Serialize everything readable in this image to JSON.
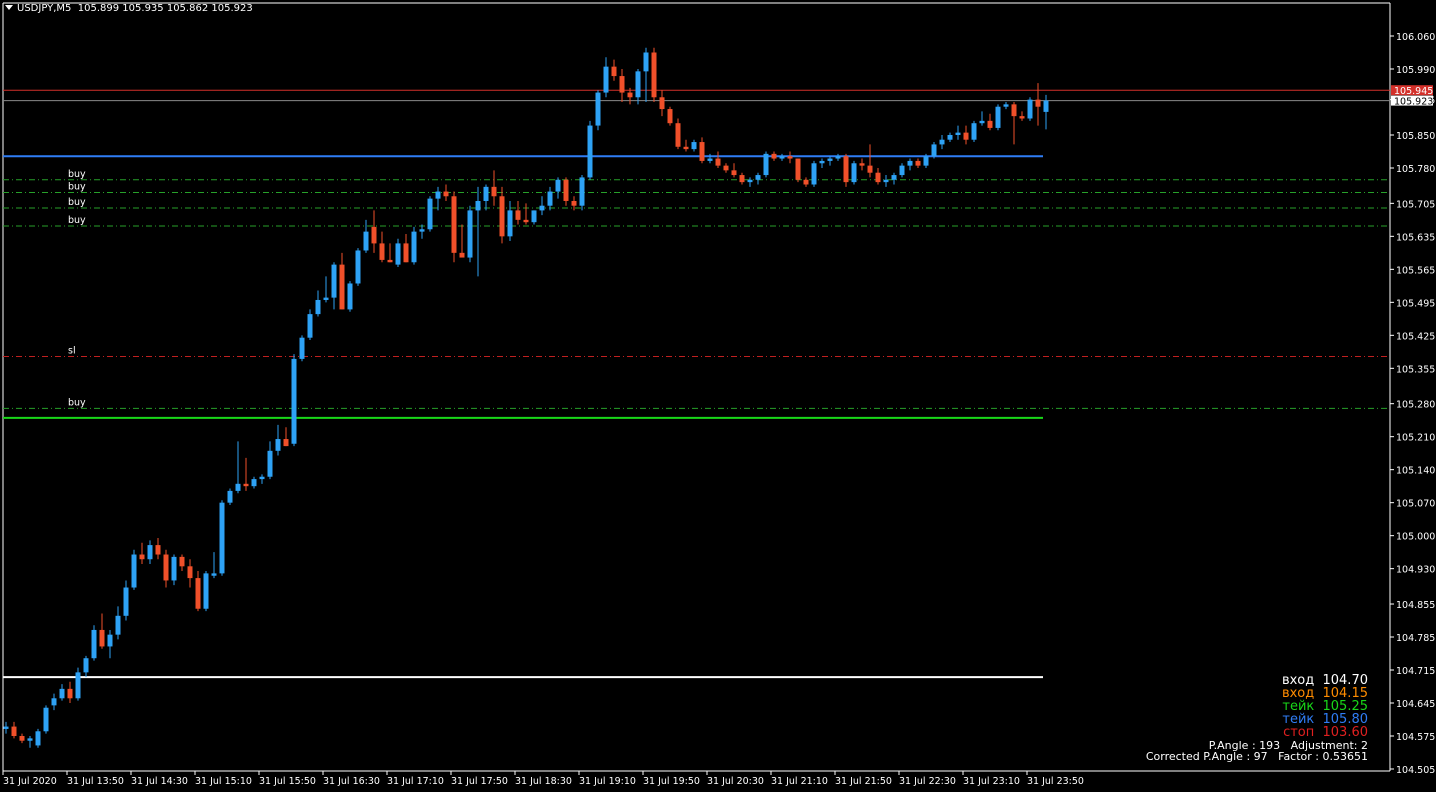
{
  "header": {
    "symbol": "USDJPY,M5",
    "ohlc": "105.899 105.935 105.862 105.923"
  },
  "colors": {
    "bull": "#2ea2f5",
    "bear": "#f0502a",
    "axis": "#ffffff",
    "ask_line": "#d3302a",
    "bid_line": "#8a8a8a"
  },
  "price_axis": {
    "min": 104.5,
    "max": 106.1,
    "ticks": [
      "106.060",
      "105.990",
      "105.925",
      "105.850",
      "105.780",
      "105.705",
      "105.635",
      "105.565",
      "105.495",
      "105.425",
      "105.355",
      "105.280",
      "105.210",
      "105.140",
      "105.070",
      "105.000",
      "104.930",
      "104.855",
      "104.785",
      "104.715",
      "104.645",
      "104.575",
      "104.505"
    ]
  },
  "time_axis": {
    "labels": [
      "31 Jul 2020",
      "31 Jul 13:50",
      "31 Jul 14:30",
      "31 Jul 15:10",
      "31 Jul 15:50",
      "31 Jul 16:30",
      "31 Jul 17:10",
      "31 Jul 17:50",
      "31 Jul 18:30",
      "31 Jul 19:10",
      "31 Jul 19:50",
      "31 Jul 20:30",
      "31 Jul 21:10",
      "31 Jul 21:50",
      "31 Jul 22:30",
      "31 Jul 23:10",
      "31 Jul 23:50"
    ]
  },
  "price_tags": [
    {
      "text": "105.945",
      "price": 105.945,
      "color": "#d3302a"
    },
    {
      "text": "105.923",
      "price": 105.923,
      "color": "#000000"
    }
  ],
  "levels": [
    {
      "price": 105.805,
      "color": "#2f7df5",
      "style": "solid",
      "label": ""
    },
    {
      "price": 105.755,
      "color": "#27a02a",
      "style": "dashdot",
      "label": "buy"
    },
    {
      "price": 105.728,
      "color": "#27a02a",
      "style": "dashdot",
      "label": "buy"
    },
    {
      "price": 105.695,
      "color": "#27a02a",
      "style": "dashdot",
      "label": "buy"
    },
    {
      "price": 105.657,
      "color": "#27a02a",
      "style": "dashdot",
      "label": "buy"
    },
    {
      "price": 105.38,
      "color": "#c02020",
      "style": "dashdot",
      "label": "sl"
    },
    {
      "price": 105.27,
      "color": "#27a02a",
      "style": "dashdot",
      "label": "buy"
    },
    {
      "price": 105.25,
      "color": "#19d719",
      "style": "solid",
      "label": ""
    },
    {
      "price": 104.7,
      "color": "#ffffff",
      "style": "solid",
      "label": ""
    }
  ],
  "info": {
    "lines": [
      {
        "text": "вход  104.70",
        "color": "#ffffff"
      },
      {
        "text": "вход  104.15",
        "color": "#ff8c00"
      },
      {
        "text": "тейк  105.25",
        "color": "#19d719"
      },
      {
        "text": "тейк  105.80",
        "color": "#2f7df5"
      },
      {
        "text": "стоп  103.60",
        "color": "#e02020"
      }
    ],
    "pangle": "P.Angle : 193   Adjustment: 2",
    "corrected": "Corrected P.Angle : 97   Factor : 0.53651"
  },
  "chart_data": {
    "type": "candlestick",
    "symbol": "USDJPY",
    "timeframe": "M5",
    "ylim": [
      104.5,
      106.1
    ],
    "candles": [
      [
        104.59,
        104.605,
        104.58,
        104.595
      ],
      [
        104.595,
        104.605,
        104.57,
        104.575
      ],
      [
        104.575,
        104.58,
        104.56,
        104.565
      ],
      [
        104.565,
        104.575,
        104.55,
        104.57
      ],
      [
        104.555,
        104.59,
        104.55,
        104.585
      ],
      [
        104.585,
        104.64,
        104.58,
        104.635
      ],
      [
        104.64,
        104.665,
        104.63,
        104.655
      ],
      [
        104.655,
        104.685,
        104.65,
        104.675
      ],
      [
        104.675,
        104.69,
        104.645,
        104.655
      ],
      [
        104.655,
        104.72,
        104.65,
        104.71
      ],
      [
        104.71,
        104.745,
        104.7,
        104.74
      ],
      [
        104.74,
        104.81,
        104.735,
        104.8
      ],
      [
        104.8,
        104.835,
        104.76,
        104.765
      ],
      [
        104.765,
        104.8,
        104.74,
        104.79
      ],
      [
        104.79,
        104.85,
        104.78,
        104.83
      ],
      [
        104.83,
        104.905,
        104.82,
        104.89
      ],
      [
        104.89,
        104.97,
        104.885,
        104.96
      ],
      [
        104.96,
        104.985,
        104.94,
        104.95
      ],
      [
        104.95,
        104.99,
        104.94,
        104.98
      ],
      [
        104.98,
        104.995,
        104.95,
        104.96
      ],
      [
        104.96,
        104.97,
        104.89,
        104.905
      ],
      [
        104.905,
        104.96,
        104.895,
        104.955
      ],
      [
        104.955,
        104.96,
        104.925,
        104.935
      ],
      [
        104.935,
        104.95,
        104.89,
        104.91
      ],
      [
        104.91,
        104.925,
        104.84,
        104.845
      ],
      [
        104.845,
        104.925,
        104.84,
        104.92
      ],
      [
        104.915,
        104.965,
        104.91,
        104.92
      ],
      [
        104.92,
        105.075,
        104.915,
        105.07
      ],
      [
        105.07,
        105.1,
        105.065,
        105.095
      ],
      [
        105.095,
        105.2,
        105.09,
        105.11
      ],
      [
        105.11,
        105.165,
        105.095,
        105.105
      ],
      [
        105.105,
        105.125,
        105.1,
        105.12
      ],
      [
        105.12,
        105.13,
        105.11,
        105.125
      ],
      [
        105.125,
        105.2,
        105.12,
        105.18
      ],
      [
        105.18,
        105.235,
        105.17,
        105.205
      ],
      [
        105.205,
        105.23,
        105.19,
        105.19
      ],
      [
        105.195,
        105.385,
        105.19,
        105.375
      ],
      [
        105.375,
        105.425,
        105.37,
        105.42
      ],
      [
        105.42,
        105.48,
        105.415,
        105.47
      ],
      [
        105.47,
        105.52,
        105.465,
        105.5
      ],
      [
        105.5,
        105.55,
        105.495,
        105.505
      ],
      [
        105.505,
        105.58,
        105.48,
        105.575
      ],
      [
        105.575,
        105.6,
        105.48,
        105.48
      ],
      [
        105.48,
        105.54,
        105.475,
        105.535
      ],
      [
        105.535,
        105.61,
        105.53,
        105.605
      ],
      [
        105.605,
        105.67,
        105.6,
        105.645
      ],
      [
        105.655,
        105.69,
        105.6,
        105.62
      ],
      [
        105.62,
        105.645,
        105.58,
        105.585
      ],
      [
        105.585,
        105.62,
        105.58,
        105.58
      ],
      [
        105.575,
        105.63,
        105.57,
        105.62
      ],
      [
        105.62,
        105.64,
        105.58,
        105.58
      ],
      [
        105.58,
        105.655,
        105.575,
        105.645
      ],
      [
        105.645,
        105.66,
        105.63,
        105.65
      ],
      [
        105.65,
        105.72,
        105.645,
        105.715
      ],
      [
        105.715,
        105.74,
        105.69,
        105.73
      ],
      [
        105.73,
        105.745,
        105.71,
        105.72
      ],
      [
        105.72,
        105.73,
        105.58,
        105.6
      ],
      [
        105.6,
        105.66,
        105.59,
        105.59
      ],
      [
        105.59,
        105.7,
        105.58,
        105.69
      ],
      [
        105.69,
        105.74,
        105.55,
        105.71
      ],
      [
        105.71,
        105.745,
        105.69,
        105.74
      ],
      [
        105.74,
        105.775,
        105.7,
        105.72
      ],
      [
        105.72,
        105.74,
        105.62,
        105.635
      ],
      [
        105.635,
        105.71,
        105.625,
        105.69
      ],
      [
        105.69,
        105.71,
        105.66,
        105.67
      ],
      [
        105.67,
        105.705,
        105.66,
        105.665
      ],
      [
        105.665,
        105.69,
        105.66,
        105.69
      ],
      [
        105.69,
        105.72,
        105.68,
        105.7
      ],
      [
        105.7,
        105.74,
        105.69,
        105.73
      ],
      [
        105.73,
        105.76,
        105.715,
        105.755
      ],
      [
        105.755,
        105.76,
        105.7,
        105.71
      ],
      [
        105.71,
        105.72,
        105.69,
        105.7
      ],
      [
        105.7,
        105.765,
        105.69,
        105.76
      ],
      [
        105.76,
        105.88,
        105.755,
        105.87
      ],
      [
        105.87,
        105.945,
        105.86,
        105.94
      ],
      [
        105.94,
        106.015,
        105.93,
        105.995
      ],
      [
        105.995,
        106.01,
        105.965,
        105.975
      ],
      [
        105.975,
        105.99,
        105.92,
        105.94
      ],
      [
        105.94,
        105.95,
        105.915,
        105.93
      ],
      [
        105.93,
        105.99,
        105.915,
        105.985
      ],
      [
        105.985,
        106.035,
        105.92,
        106.025
      ],
      [
        106.025,
        106.035,
        105.92,
        105.93
      ],
      [
        105.93,
        105.945,
        105.89,
        105.905
      ],
      [
        105.905,
        105.91,
        105.87,
        105.875
      ],
      [
        105.875,
        105.885,
        105.82,
        105.825
      ],
      [
        105.825,
        105.84,
        105.815,
        105.82
      ],
      [
        105.82,
        105.84,
        105.815,
        105.835
      ],
      [
        105.835,
        105.845,
        105.79,
        105.795
      ],
      [
        105.795,
        105.81,
        105.79,
        105.8
      ],
      [
        105.8,
        105.815,
        105.78,
        105.785
      ],
      [
        105.785,
        105.79,
        105.77,
        105.775
      ],
      [
        105.775,
        105.79,
        105.76,
        105.765
      ],
      [
        105.765,
        105.77,
        105.745,
        105.75
      ],
      [
        105.75,
        105.76,
        105.74,
        105.755
      ],
      [
        105.755,
        105.77,
        105.745,
        105.765
      ],
      [
        105.765,
        105.815,
        105.76,
        105.81
      ],
      [
        105.81,
        105.815,
        105.795,
        105.8
      ],
      [
        105.8,
        105.81,
        105.795,
        105.805
      ],
      [
        105.805,
        105.815,
        105.79,
        105.8
      ],
      [
        105.8,
        105.8,
        105.75,
        105.755
      ],
      [
        105.755,
        105.76,
        105.74,
        105.745
      ],
      [
        105.745,
        105.795,
        105.74,
        105.79
      ],
      [
        105.79,
        105.8,
        105.78,
        105.795
      ],
      [
        105.795,
        105.805,
        105.785,
        105.8
      ],
      [
        105.8,
        105.81,
        105.795,
        105.805
      ],
      [
        105.805,
        105.81,
        105.74,
        105.75
      ],
      [
        105.75,
        105.795,
        105.745,
        105.79
      ],
      [
        105.79,
        105.8,
        105.775,
        105.785
      ],
      [
        105.785,
        105.83,
        105.76,
        105.77
      ],
      [
        105.77,
        105.78,
        105.745,
        105.75
      ],
      [
        105.75,
        105.765,
        105.74,
        105.755
      ],
      [
        105.755,
        105.77,
        105.745,
        105.765
      ],
      [
        105.765,
        105.79,
        105.76,
        105.785
      ],
      [
        105.785,
        105.8,
        105.775,
        105.795
      ],
      [
        105.795,
        105.8,
        105.78,
        105.785
      ],
      [
        105.785,
        105.81,
        105.78,
        105.805
      ],
      [
        105.805,
        105.835,
        105.8,
        105.83
      ],
      [
        105.83,
        105.85,
        105.82,
        105.84
      ],
      [
        105.84,
        105.855,
        105.835,
        105.85
      ],
      [
        105.85,
        105.87,
        105.84,
        105.855
      ],
      [
        105.855,
        105.87,
        105.83,
        105.84
      ],
      [
        105.84,
        105.88,
        105.835,
        105.875
      ],
      [
        105.875,
        105.9,
        105.87,
        105.88
      ],
      [
        105.88,
        105.895,
        105.86,
        105.865
      ],
      [
        105.865,
        105.915,
        105.86,
        105.91
      ],
      [
        105.91,
        105.92,
        105.905,
        105.915
      ],
      [
        105.915,
        105.92,
        105.83,
        105.89
      ],
      [
        105.89,
        105.9,
        105.88,
        105.885
      ],
      [
        105.885,
        105.93,
        105.88,
        105.925
      ],
      [
        105.925,
        105.96,
        105.87,
        105.91
      ],
      [
        105.899,
        105.935,
        105.862,
        105.923
      ]
    ]
  }
}
